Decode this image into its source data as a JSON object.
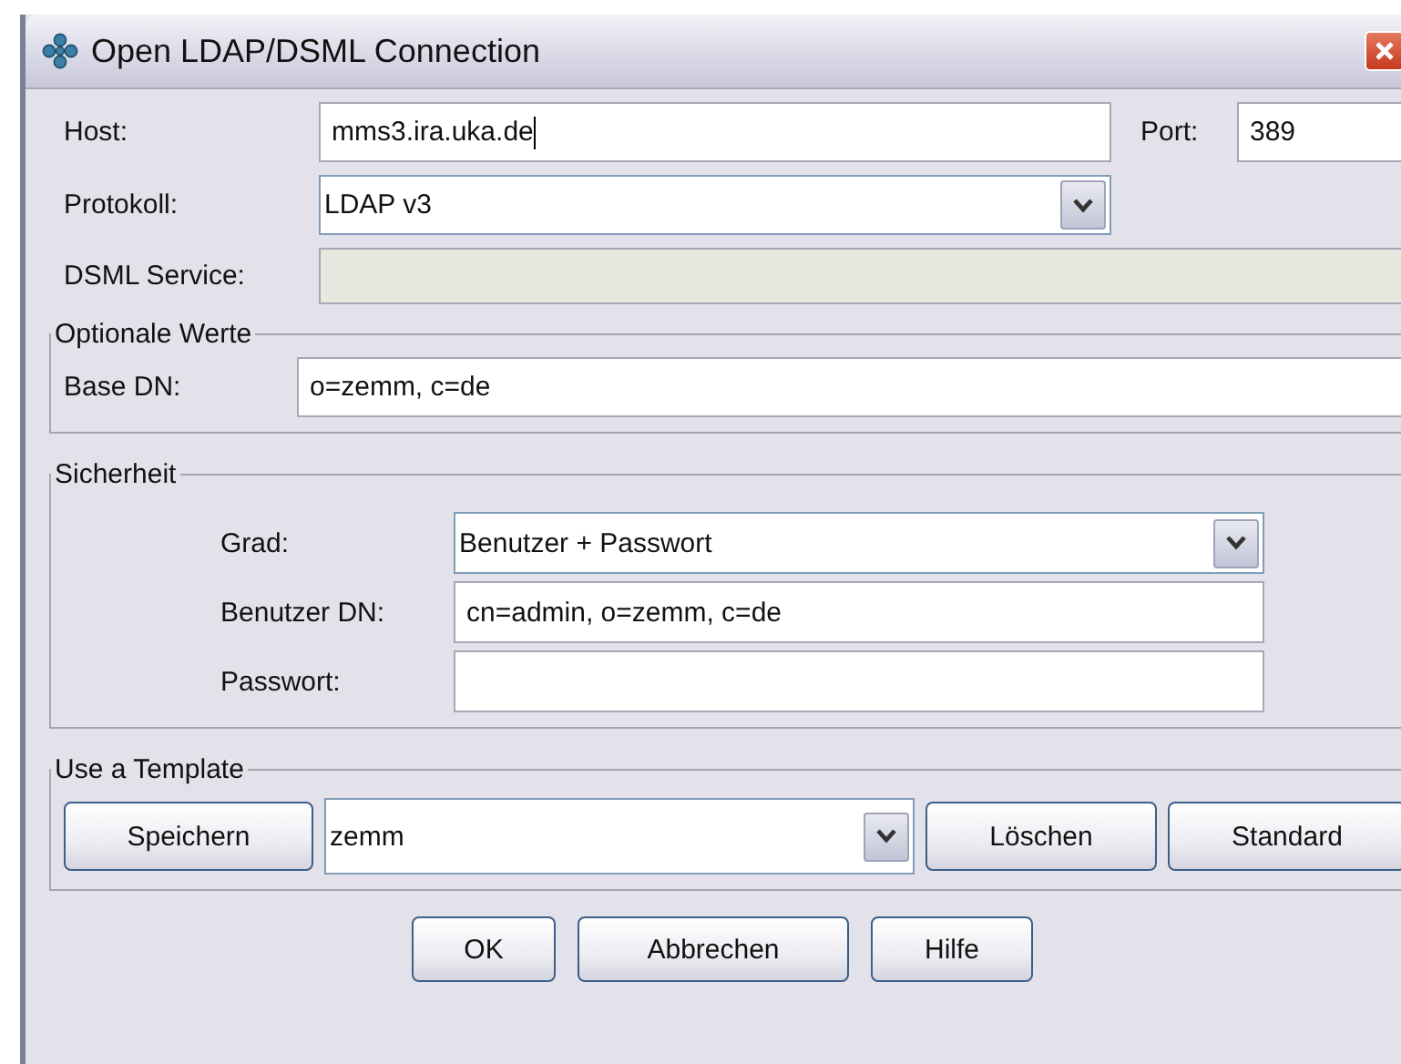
{
  "window": {
    "title": "Open LDAP/DSML Connection"
  },
  "connection": {
    "host": {
      "label": "Host:",
      "value": "mms3.ira.uka.de"
    },
    "port": {
      "label": "Port:",
      "value": "389"
    },
    "protocol": {
      "label": "Protokoll:",
      "value": "LDAP v3"
    },
    "dsml_service": {
      "label": "DSML Service:",
      "disabled": true
    }
  },
  "optional_values": {
    "title": "Optionale Werte",
    "base_dn": {
      "label": "Base DN:",
      "value": "o=zemm, c=de"
    }
  },
  "security": {
    "title": "Sicherheit",
    "level": {
      "label": "Grad:",
      "value": "Benutzer + Passwort"
    },
    "user_dn": {
      "label": "Benutzer DN:",
      "value": "cn=admin, o=zemm, c=de"
    },
    "password": {
      "label": "Passwort:"
    }
  },
  "template": {
    "title": "Use a Template",
    "save": "Speichern",
    "name": "zemm",
    "delete": "Löschen",
    "default": "Standard"
  },
  "buttons": [
    "OK",
    "Abbrechen",
    "Hilfe"
  ]
}
